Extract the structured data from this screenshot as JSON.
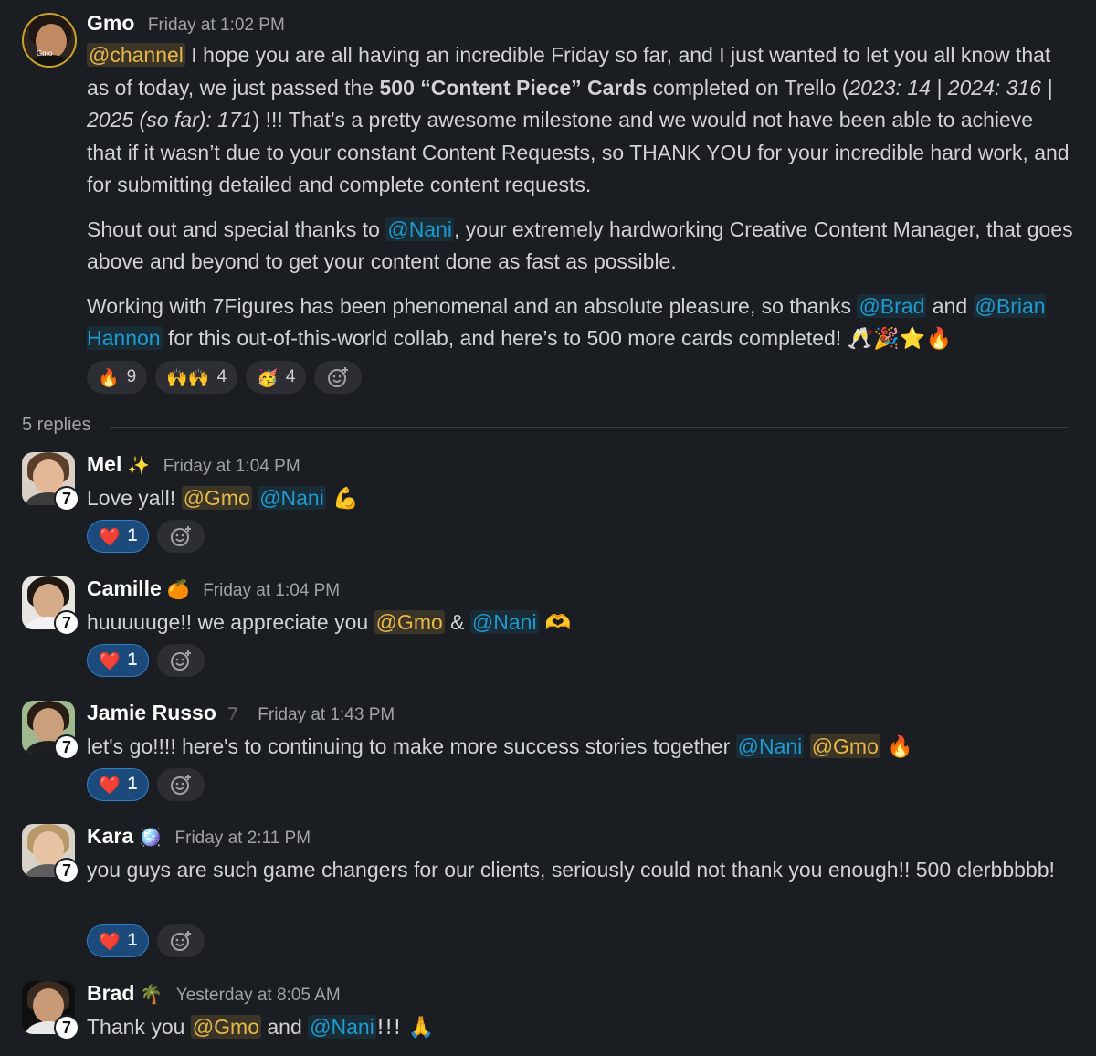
{
  "main_message": {
    "author": "Gmo",
    "timestamp": "Friday at 1:02 PM",
    "avatar_text": "Gmo",
    "paragraph1": {
      "mention": "@channel",
      "t1": " I hope you are all having an incredible Friday so far, and I just wanted to let you all know that as of today, we just passed the ",
      "bold": "500 “Content Piece” Cards",
      "t2": " completed on Trello (",
      "italic": "2023: 14 | 2024: 316 | 2025 (so far): 171",
      "t3": ") !!! That’s a pretty awesome milestone and we would not have been able to achieve that if it wasn’t due to your constant Content Requests, so THANK YOU for your incredible hard work, and for submitting detailed and complete content requests."
    },
    "paragraph2": {
      "t1": "Shout out and special thanks to ",
      "mention": "@Nani",
      "t2": ", your extremely hardworking Creative Content Manager, that goes above and beyond to get your content done as fast as possible."
    },
    "paragraph3": {
      "t1": "Working with 7Figures has been phenomenal and an absolute pleasure, so thanks ",
      "mention1": "@Brad",
      "t2": " and ",
      "mention2": "@Brian Hannon",
      "t3": " for this out-of-this-world collab, and here’s to 500 more cards completed! ",
      "emojis": "🥂🎉⭐🔥"
    },
    "reactions": [
      {
        "emoji": "🔥",
        "count": "9"
      },
      {
        "emoji": "🙌🙌",
        "count": "4"
      },
      {
        "emoji": "🥳",
        "count": "4"
      }
    ]
  },
  "thread": {
    "replies_label": "5 replies"
  },
  "replies": [
    {
      "author": "Mel",
      "status": "✨",
      "timestamp": "Friday at 1:04 PM",
      "text_before": "Love yall! ",
      "mention1": "@Gmo",
      "between": " ",
      "mention2": "@Nani",
      "after": " 💪",
      "reaction_emoji": "❤️",
      "reaction_count": "1"
    },
    {
      "author": "Camille",
      "status": "🍊",
      "timestamp": "Friday at 1:04 PM",
      "text_before": "huuuuuge!! we appreciate you ",
      "mention1": "@Gmo",
      "between": " & ",
      "mention2": "@Nani",
      "after": " 🫶",
      "reaction_emoji": "❤️",
      "reaction_count": "1"
    },
    {
      "author": "Jamie Russo",
      "status": "7️",
      "timestamp": "Friday at 1:43 PM",
      "text_before": "let's go!!!! here's to continuing to make more success stories together ",
      "mention1": "@Nani",
      "between": " ",
      "mention2": "@Gmo",
      "after": " 🔥",
      "reaction_emoji": "❤️",
      "reaction_count": "1"
    },
    {
      "author": "Kara",
      "status": "🪩",
      "timestamp": "Friday at 2:11 PM",
      "text": "you guys are such game changers for our clients, seriously could not thank you enough!! 500 clerbbbbb!",
      "reaction_emoji": "❤️",
      "reaction_count": "1"
    },
    {
      "author": "Brad",
      "status": "🌴",
      "timestamp": "Yesterday at 8:05 AM",
      "text_before": "Thank you ",
      "mention1": "@Gmo",
      "between": " and ",
      "mention2": "@Nani",
      "after": "!!! 🙏"
    }
  ],
  "badge_label": "7",
  "icons": {
    "add_reaction": "add-reaction-icon"
  }
}
